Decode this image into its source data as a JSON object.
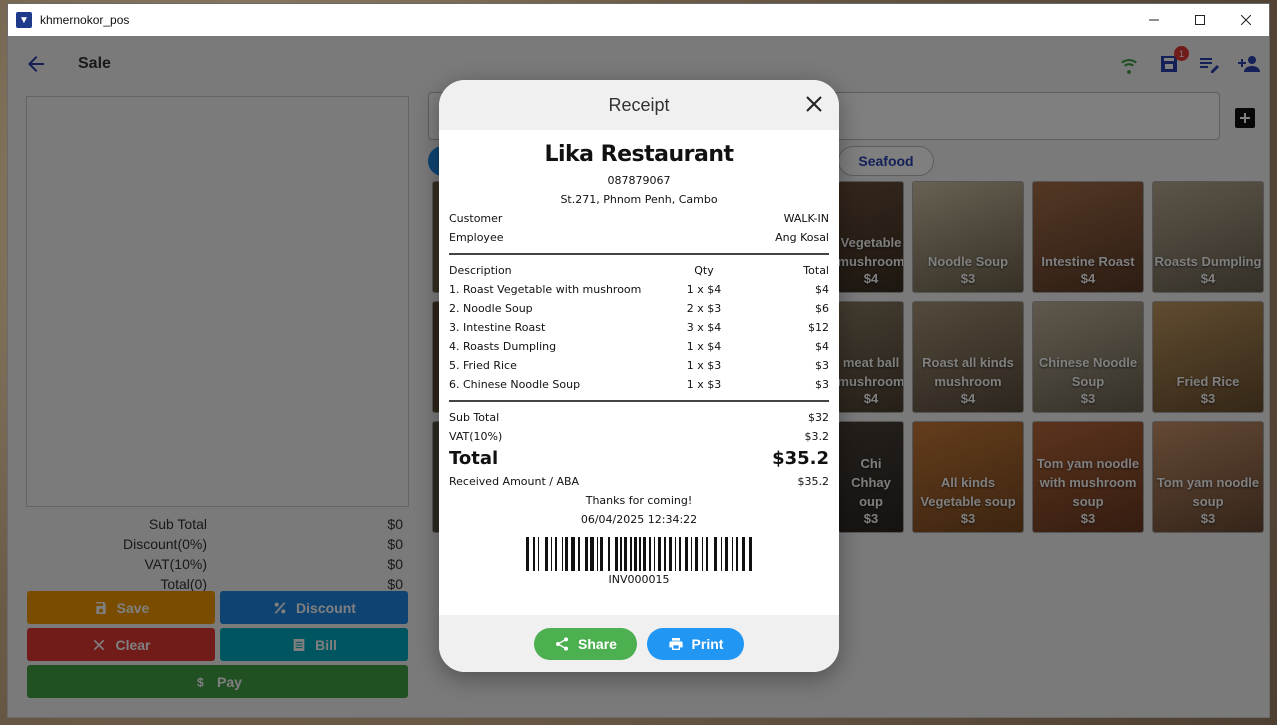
{
  "window": {
    "title": "khmernokor_pos",
    "icon": "app-logo-icon"
  },
  "appbar": {
    "title": "Sale",
    "badge_count": "1",
    "icons": [
      "wifi-icon",
      "store-icon",
      "edit-list-icon",
      "add-person-icon"
    ]
  },
  "summary": [
    {
      "label": "Sub Total",
      "value": "$0"
    },
    {
      "label": "Discount(0%)",
      "value": "$0"
    },
    {
      "label": "VAT(10%)",
      "value": "$0"
    },
    {
      "label": "Total(0)",
      "value": "$0"
    }
  ],
  "actions": {
    "save": "Save",
    "discount": "Discount",
    "clear": "Clear",
    "bill": "Bill",
    "pay": "Pay"
  },
  "categories": {
    "visible": [
      "Seafood"
    ]
  },
  "products": [
    {
      "name": "Vegetable mushroom",
      "price": "$4"
    },
    {
      "name": "Noodle Soup",
      "price": "$3"
    },
    {
      "name": "Intestine Roast",
      "price": "$4"
    },
    {
      "name": "Roasts Dumpling",
      "price": "$4"
    },
    {
      "name": "meat ball mushroom",
      "price": "$4"
    },
    {
      "name": "Roast all kinds mushroom",
      "price": "$4"
    },
    {
      "name": "Chinese Noodle Soup",
      "price": "$3"
    },
    {
      "name": "Fried Rice",
      "price": "$3"
    },
    {
      "name": "Chi Chhay oup",
      "price": "$3"
    },
    {
      "name": "All kinds Vegetable soup",
      "price": "$3"
    },
    {
      "name": "Tom yam noodle with mushroom soup",
      "price": "$3"
    },
    {
      "name": "Tom yam noodle soup",
      "price": "$3"
    }
  ],
  "receipt": {
    "dialog_title": "Receipt",
    "restaurant": "Lika Restaurant",
    "phone": "087879067",
    "address": "St.271, Phnom Penh, Cambo",
    "customer_label": "Customer",
    "customer_value": "WALK-IN",
    "employee_label": "Employee",
    "employee_value": "Ang Kosal",
    "headers": {
      "description": "Description",
      "qty": "Qty",
      "total": "Total"
    },
    "items": [
      {
        "desc": "1. Roast Vegetable with mushroom",
        "qty": "1 x $4",
        "total": "$4"
      },
      {
        "desc": "2. Noodle Soup",
        "qty": "2 x $3",
        "total": "$6"
      },
      {
        "desc": "3. Intestine Roast",
        "qty": "3 x $4",
        "total": "$12"
      },
      {
        "desc": "4. Roasts Dumpling",
        "qty": "1 x $4",
        "total": "$4"
      },
      {
        "desc": "5. Fried Rice",
        "qty": "1 x $3",
        "total": "$3"
      },
      {
        "desc": "6. Chinese Noodle Soup",
        "qty": "1 x $3",
        "total": "$3"
      }
    ],
    "subtotal_label": "Sub Total",
    "subtotal_value": "$32",
    "vat_label": "VAT(10%)",
    "vat_value": "$3.2",
    "total_label": "Total",
    "total_value": "$35.2",
    "received_label": "Received Amount / ABA",
    "received_value": "$35.2",
    "thanks": "Thanks for coming!",
    "datetime": "06/04/2025 12:34:22",
    "invoice": "INV000015",
    "share_label": "Share",
    "print_label": "Print"
  },
  "colors": {
    "save": "#f29900",
    "discount": "#1e88e5",
    "clear": "#e53935",
    "bill": "#00acc1",
    "pay": "#43a047",
    "share": "#4caf50",
    "print": "#2196f3",
    "primary": "#2a3fb0"
  }
}
